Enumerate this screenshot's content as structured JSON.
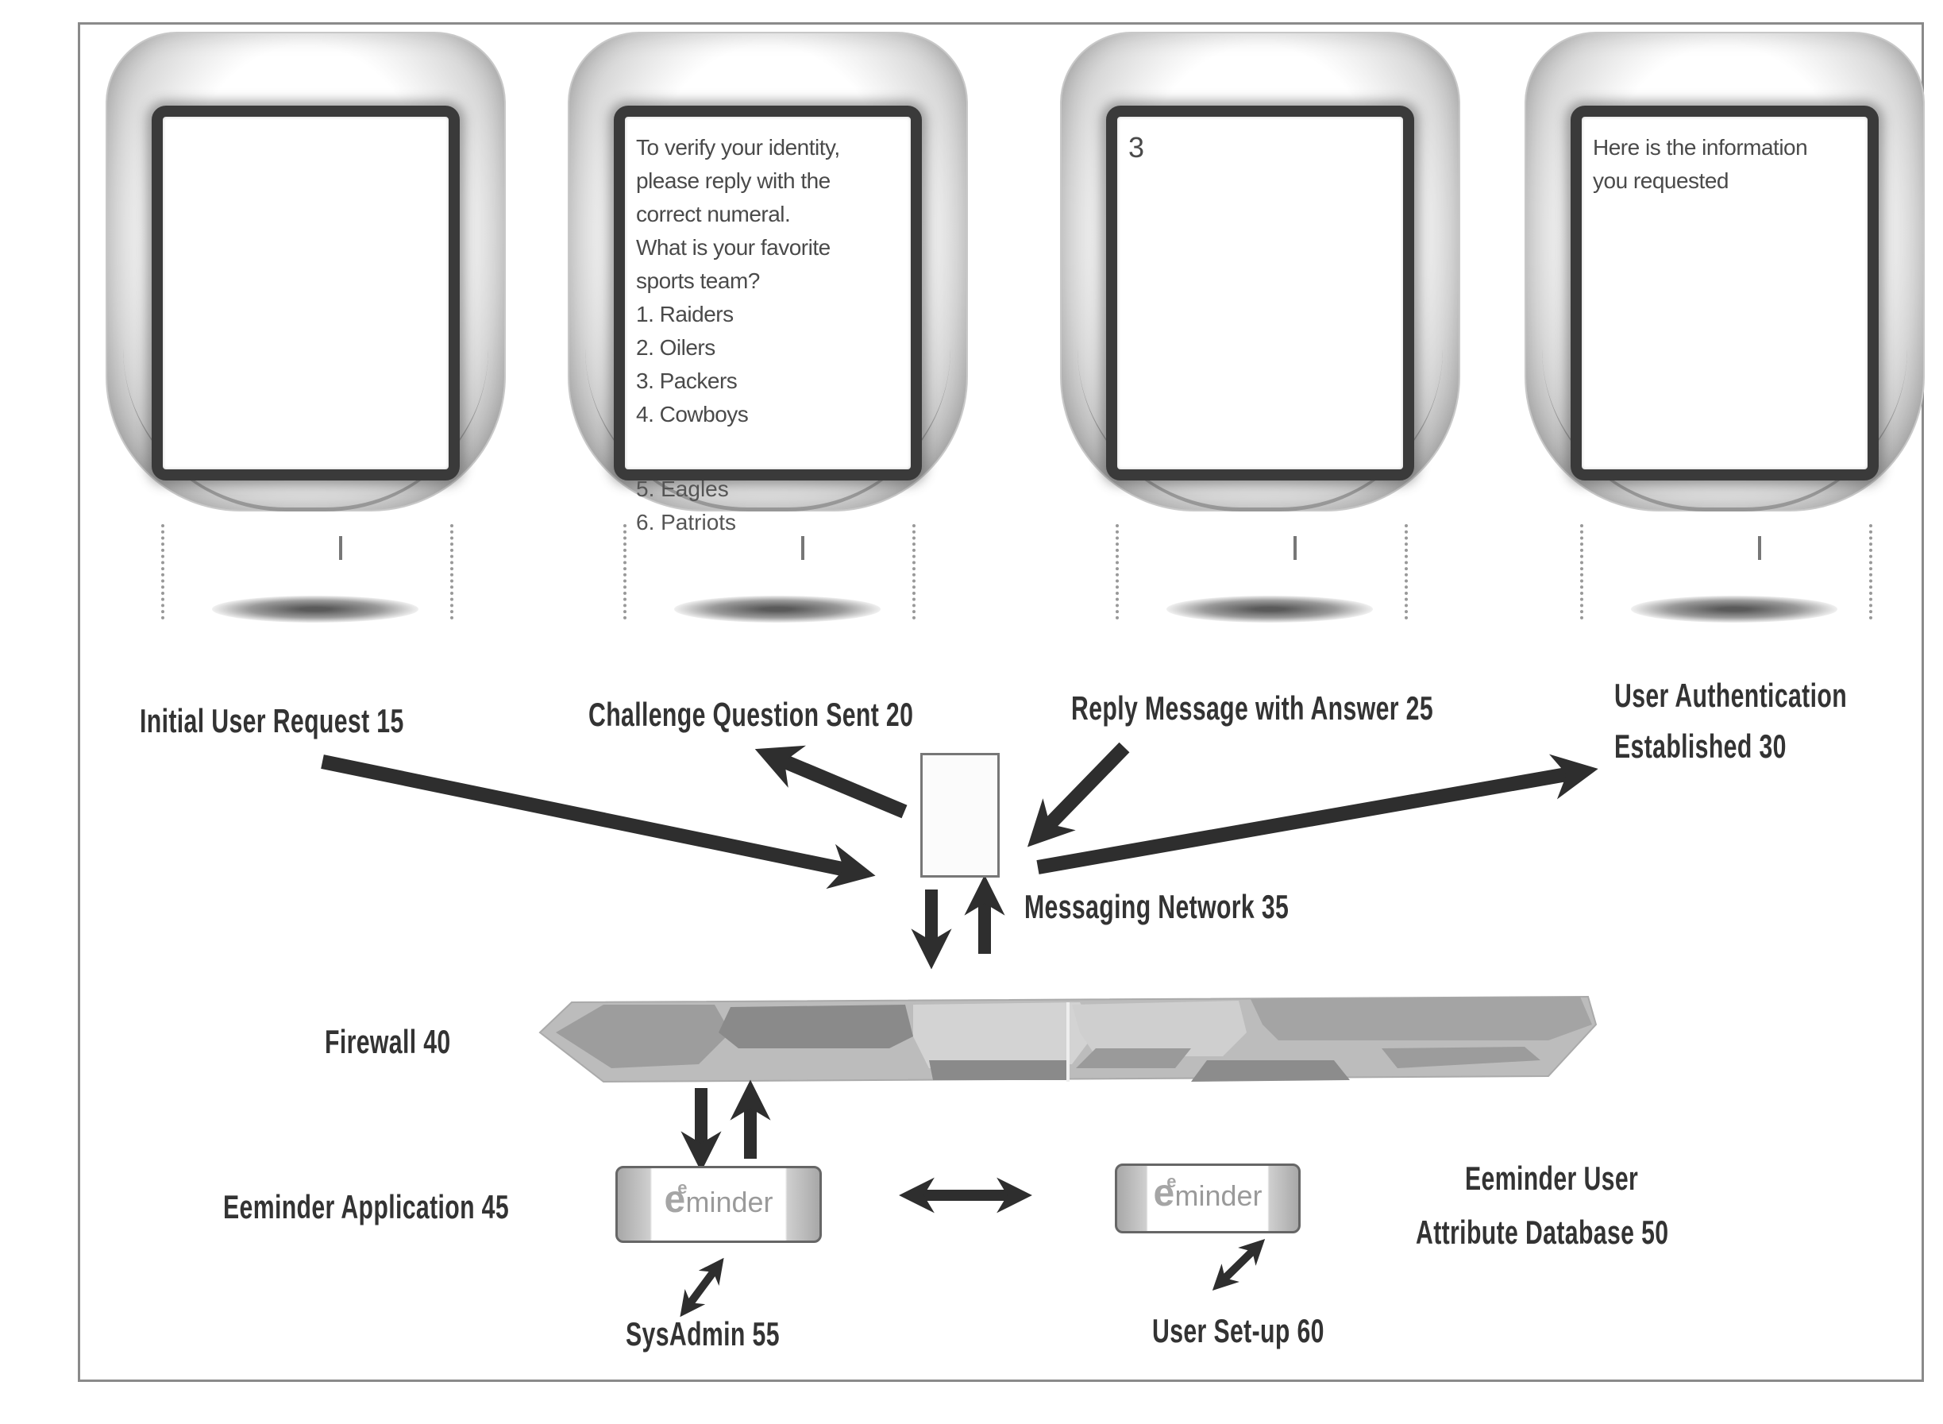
{
  "figure": {
    "phones": [
      {
        "id": "phone-1",
        "screen_lines": [],
        "overflow_lines": []
      },
      {
        "id": "phone-2",
        "screen_lines": [
          "To verify your identity,",
          "please reply with the",
          "correct numeral.",
          "What is your favorite",
          "sports team?",
          "1. Raiders",
          "2. Oilers",
          "3. Packers",
          "4. Cowboys"
        ],
        "overflow_lines": [
          "5. Eagles",
          "6. Patriots"
        ]
      },
      {
        "id": "phone-3",
        "screen_lines": [
          "3"
        ],
        "overflow_lines": []
      },
      {
        "id": "phone-4",
        "screen_lines": [
          "Here is the information",
          "you requested"
        ],
        "overflow_lines": []
      }
    ],
    "labels": {
      "initial_request": "Initial User Request 15",
      "challenge_sent": "Challenge Question Sent 20",
      "reply_message": "Reply Message with Answer 25",
      "auth_line1": "User Authentication",
      "auth_line2": "Established 30",
      "messaging_network": "Messaging Network 35",
      "firewall": "Firewall 40",
      "application": "Eeminder Application 45",
      "database_line1": "Eeminder User",
      "database_line2": "Attribute Database 50",
      "sysadmin": "SysAdmin 55",
      "user_setup": "User Set-up 60"
    },
    "logo": {
      "letter": "e",
      "superscript": "e",
      "rest": "minder"
    },
    "colors": {
      "arrow": "#2e2e2e",
      "text": "#333333",
      "frame": "#8a8a8a"
    }
  }
}
